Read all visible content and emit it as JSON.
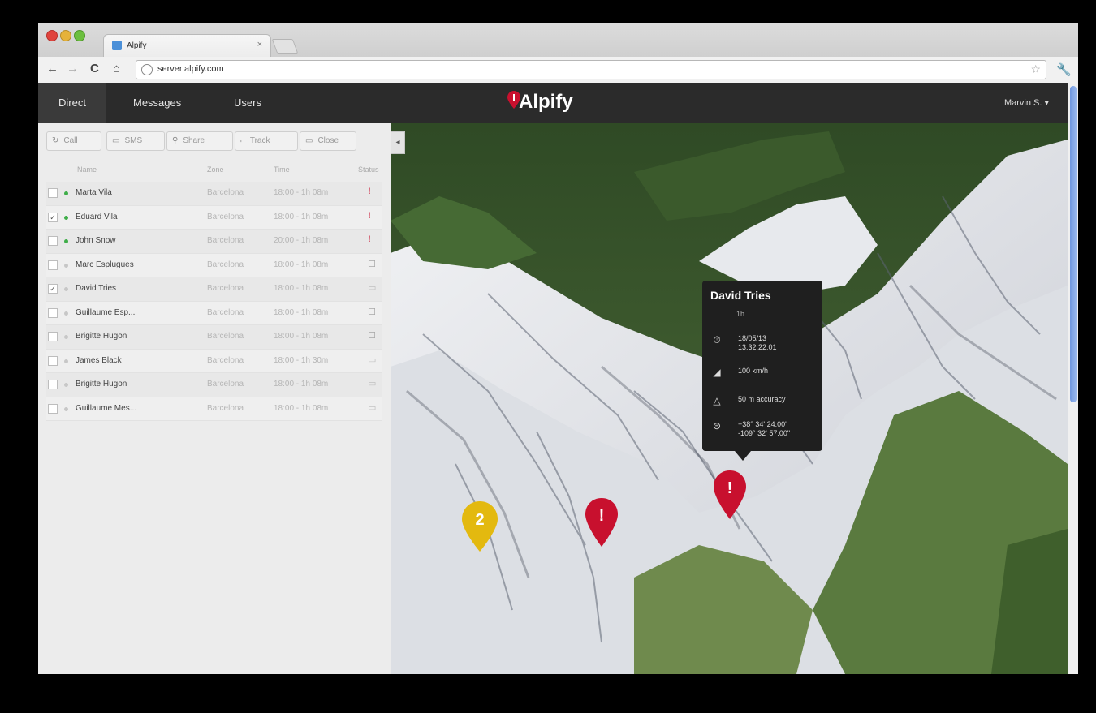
{
  "browser": {
    "tab_title": "Alpify",
    "tab_close": "×",
    "url": "server.alpify.com",
    "nav": {
      "back": "←",
      "forward": "→",
      "reload": "C",
      "home": "⌂",
      "star": "☆",
      "wrench": "🔧"
    }
  },
  "app": {
    "brand": "Alpify",
    "nav": [
      "Direct",
      "Messages",
      "Users"
    ],
    "active_nav": "Direct",
    "user_menu": "Marvin S. ▾",
    "brand_color": "#c8102e"
  },
  "panel": {
    "toolbar": [
      {
        "icon": "↻",
        "label": "Call"
      },
      {
        "icon": "▭",
        "label": "SMS"
      },
      {
        "icon": "⚲",
        "label": "Share"
      },
      {
        "icon": "⌐",
        "label": "Track"
      },
      {
        "icon": "▭",
        "label": "Close"
      }
    ],
    "columns": [
      "Name",
      "Zone",
      "Time",
      "Status"
    ],
    "collapse_icon": "◂",
    "rows": [
      {
        "checked": false,
        "dot": "#3fae49",
        "name": "Marta Vila",
        "area": "Barcelona",
        "time": "18:00 - 1h 08m",
        "status": "alert"
      },
      {
        "checked": true,
        "dot": "#3fae49",
        "name": "Eduard Vila",
        "area": "Barcelona",
        "time": "18:00 - 1h 08m",
        "status": "alert"
      },
      {
        "checked": false,
        "dot": "#3fae49",
        "name": "John Snow",
        "area": "Barcelona",
        "time": "20:00 - 1h 08m",
        "status": "alert"
      },
      {
        "checked": false,
        "dot": "#c7c7c7",
        "name": "Marc Esplugues",
        "area": "Barcelona",
        "time": "18:00 - 1h 08m",
        "status": "msg"
      },
      {
        "checked": true,
        "dot": "#c7c7c7",
        "name": "David Tries",
        "area": "Barcelona",
        "time": "18:00 - 1h 08m",
        "status": "box"
      },
      {
        "checked": false,
        "dot": "#c7c7c7",
        "name": "Guillaume Esp...",
        "area": "Barcelona",
        "time": "18:00 - 1h 08m",
        "status": "msg"
      },
      {
        "checked": false,
        "dot": "#c7c7c7",
        "name": "Brigitte Hugon",
        "area": "Barcelona",
        "time": "18:00 - 1h 08m",
        "status": "msg"
      },
      {
        "checked": false,
        "dot": "#c7c7c7",
        "name": "James Black",
        "area": "Barcelona",
        "time": "18:00 - 1h 30m",
        "status": "box"
      },
      {
        "checked": false,
        "dot": "#c7c7c7",
        "name": "Brigitte Hugon",
        "area": "Barcelona",
        "time": "18:00 - 1h 08m",
        "status": "box"
      },
      {
        "checked": false,
        "dot": "#c7c7c7",
        "name": "Guillaume Mes...",
        "area": "Barcelona",
        "time": "18:00 - 1h 08m",
        "status": "box"
      }
    ],
    "status_icons": {
      "alert": "!",
      "msg": "☐",
      "box": "▭"
    },
    "check_mark": "✓"
  },
  "popup": {
    "name": "David Tries",
    "subtitle": "1h",
    "rows": [
      {
        "icon": "⏱",
        "text": "18/05/13",
        "text2": "13:32:22:01"
      },
      {
        "icon": "◢",
        "text": "100 km/h",
        "text2": ""
      },
      {
        "icon": "△",
        "text": "50 m accuracy",
        "text2": ""
      },
      {
        "icon": "⊜",
        "text": "+38° 34' 24.00\"",
        "text2": "-109° 32' 57.00\""
      }
    ]
  },
  "markers": [
    {
      "kind": "group",
      "label": "2",
      "color": "#e3b90f"
    },
    {
      "kind": "alert",
      "label": "!",
      "color": "#c8102e"
    },
    {
      "kind": "alert",
      "label": "!",
      "color": "#c8102e"
    }
  ]
}
